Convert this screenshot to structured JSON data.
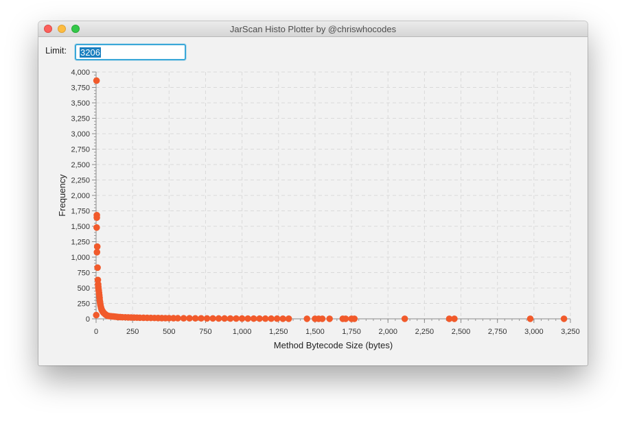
{
  "window": {
    "title": "JarScan Histo Plotter by @chriswhocodes"
  },
  "controls": {
    "limit_label": "Limit:",
    "limit_value": "3206"
  },
  "colors": {
    "point": "#f15a2b",
    "input_focus": "#3aa8d8",
    "selection": "#1a7fbf"
  },
  "chart_data": {
    "type": "scatter",
    "xlabel": "Method Bytecode Size (bytes)",
    "ylabel": "Frequency",
    "xlim": [
      0,
      3250
    ],
    "ylim": [
      0,
      4000
    ],
    "grid": true,
    "x_ticks": [
      "0",
      "250",
      "500",
      "750",
      "1,000",
      "1,250",
      "1,500",
      "1,750",
      "2,000",
      "2,250",
      "2,500",
      "2,750",
      "3,000",
      "3,250"
    ],
    "y_ticks": [
      "0",
      "250",
      "500",
      "750",
      "1,000",
      "1,250",
      "1,500",
      "1,750",
      "2,000",
      "2,250",
      "2,500",
      "2,750",
      "3,000",
      "3,250",
      "3,500",
      "3,750",
      "4,000"
    ],
    "series": [
      {
        "x": [
          1,
          3,
          5,
          5,
          4,
          8,
          6,
          10,
          12,
          14,
          15,
          16,
          18,
          20,
          22,
          24,
          25,
          27,
          28,
          30,
          33,
          35,
          38,
          40,
          42,
          45,
          48,
          50,
          55,
          60,
          65,
          70,
          75,
          80,
          90,
          100,
          110,
          120,
          130,
          140,
          150,
          165,
          180,
          200,
          220,
          240,
          260,
          280,
          300,
          325,
          350,
          375,
          400,
          425,
          450,
          475,
          500,
          530,
          560,
          600,
          640,
          680,
          720,
          760,
          800,
          840,
          880,
          920,
          960,
          1000,
          1040,
          1080,
          1120,
          1160,
          1200,
          1240,
          1280,
          1320,
          1445,
          1500,
          1525,
          1550,
          1600,
          1690,
          1710,
          1750,
          1770,
          2115,
          2420,
          2455,
          2975,
          3206
        ],
        "y": [
          60,
          3860,
          1680,
          1640,
          1480,
          1170,
          1080,
          830,
          630,
          560,
          520,
          490,
          460,
          420,
          380,
          340,
          300,
          270,
          250,
          220,
          190,
          170,
          150,
          140,
          130,
          120,
          110,
          100,
          90,
          80,
          70,
          60,
          55,
          50,
          45,
          42,
          40,
          38,
          35,
          33,
          30,
          28,
          26,
          25,
          23,
          22,
          20,
          19,
          18,
          17,
          16,
          15,
          14,
          13,
          12,
          11,
          11,
          10,
          10,
          9,
          9,
          8,
          8,
          7,
          7,
          6,
          6,
          5,
          5,
          5,
          4,
          4,
          4,
          3,
          3,
          3,
          2,
          2,
          1,
          1,
          1,
          1,
          1,
          1,
          1,
          1,
          1,
          1,
          1,
          1,
          1,
          1
        ]
      }
    ]
  }
}
